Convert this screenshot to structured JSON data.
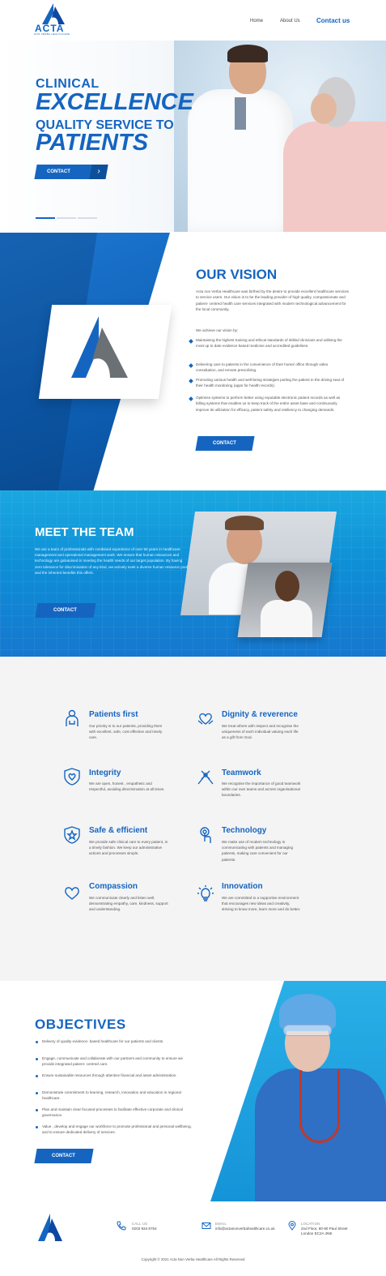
{
  "brand": {
    "name": "ACTA",
    "tagline": "NON VERBA HEALTHCARE",
    "primary_color": "#1565c0",
    "accent_color": "#1aa8e0"
  },
  "nav": {
    "home": "Home",
    "about": "About Us",
    "contact": "Contact us"
  },
  "hero": {
    "line1": "CLINICAL",
    "line2": "EXCELLENCE",
    "line3": "QUALITY SERVICE TO",
    "line4": "PATIENTS",
    "button": "CONTACT",
    "arrow_icon": "chevron-right-icon",
    "slides": 3,
    "active_slide": 1
  },
  "vision": {
    "title": "OUR VISION",
    "intro": "Acta non Verba Healthcare was birthed by the desire to provide excellent healthcare services to service users. Our vision is to be the leading provider of high quality, compassionate and patient- centred health care services integrated with modern technological advancement for the local community.",
    "achieve": "We achieve our vision by:",
    "items": [
      "Maintaining the highest training and ethical standards of skilled clinicians and utilising the most up to date evidence based medicine and accredited guidelines.",
      "Delivering care to patients in the convenience of their home/ office through video consultation, and remote prescribing.",
      "Promoting various health and well-being strategies putting the patient in the driving seat of their health monitoring (apps for health records).",
      "Optimise systems to perform better using reputable electronic patient records as well as billing systems that enables us to keep track of the entire asset base and continuously improve its utilization for efficacy, patient safety and resiliency to changing demands."
    ],
    "button": "CONTACT"
  },
  "team": {
    "title": "MEET THE TEAM",
    "text": "We are a team of professionals with combined experience of over 50 years in healthcare management and operational management work. We ensure that human resources and technology are galvanised in meeting the health needs of our target population. By having zero tolerance for discrimination of any kind, we actively seek a diverse human resource pool and the inherent benefits this offers.",
    "button": "CONTACT"
  },
  "values": [
    {
      "title": "Patients first",
      "icon": "patient-icon",
      "text": "Our priority is to our patients, providing them with excellent, safe, cost effective and timely care."
    },
    {
      "title": "Dignity & reverence",
      "icon": "handshake-heart-icon",
      "text": "We treat others with respect and recognise the uniqueness of each individual valuing each life as a gift from God."
    },
    {
      "title": "Integrity",
      "icon": "shield-heart-icon",
      "text": "We are open, honest , empathetic and respectful, avoiding discrimination at all times."
    },
    {
      "title": "Teamwork",
      "icon": "teamwork-hands-icon",
      "text": "We recognise the importance of good teamwork within our own teams and across organisational boundaries."
    },
    {
      "title": "Safe & efficient",
      "icon": "shield-star-icon",
      "text": "We provide safe clinical care to every patient, in a timely fashion. We keep our administrative actions and processes simple."
    },
    {
      "title": "Technology",
      "icon": "touch-tech-icon",
      "text": "We make use of modern technology in communicating with patients and managing patients, making care convenient for our patients."
    },
    {
      "title": "Compassion",
      "icon": "heart-hands-icon",
      "text": "We communicate clearly and listen well, demonstrating empathy, care, kindness, support and understanding."
    },
    {
      "title": "Innovation",
      "icon": "lightbulb-icon",
      "text": "We are committed to a supportive environment that encourages new ideas and creativity, striving to know more, learn more and do better."
    }
  ],
  "objectives": {
    "title": "OBJECTIVES",
    "items": [
      "Delivery of quality evidence- based healthcare for our patients and clients.",
      "Engage, communicate and collaborate with our partners and community to ensure we provide integrated patient- centred care.",
      "Ensure sustainable resources through attentive financial and asset administration.",
      "Demonstrate commitment to learning, research, innovation and education in regional healthcare.",
      "Plan and maintain clear focused processes to facilitate effective corporate and clinical governance.",
      "Value , develop and engage our workforce to promote professional and personal wellbeing, and to ensure dedicated delivery of services."
    ],
    "button": "CONTACT"
  },
  "footer": {
    "call_label": "CALL US",
    "call_value": "0203 934 8754",
    "email_label": "EMAIL",
    "email_value": "info@actanonverbahealthcare.co.uk",
    "location_label": "LOCATION",
    "location_line1": "2nd Floor, 80-90 Paul Street",
    "location_line2": "London EC2A 4NE",
    "copyright": "Copyright © 2021 Acta Non Verba Healthcare All Rights Reserved"
  }
}
